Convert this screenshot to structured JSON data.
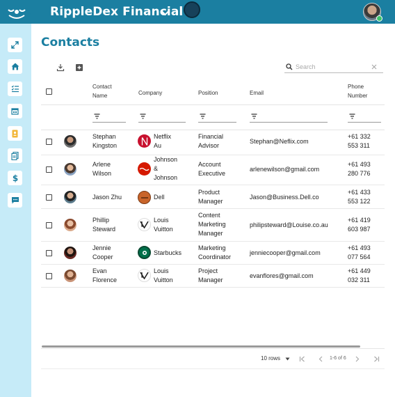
{
  "app": {
    "brand": "RippleDex Financial",
    "accent_color": "#1b7fa1",
    "sidebar_color": "#c6ebf8"
  },
  "sidebar": {
    "items": [
      {
        "icon": "expand-icon"
      },
      {
        "icon": "home-icon"
      },
      {
        "icon": "checklist-icon"
      },
      {
        "icon": "calendar-icon"
      },
      {
        "icon": "contacts-book-icon"
      },
      {
        "icon": "documents-icon"
      },
      {
        "icon": "dollar-icon"
      },
      {
        "icon": "chat-icon"
      }
    ]
  },
  "page": {
    "title": "Contacts",
    "search_placeholder": "Search"
  },
  "table": {
    "columns": {
      "contact_name": "Contact\nName",
      "company": "Company",
      "position": "Position",
      "email": "Email",
      "phone": "Phone\nNumber"
    },
    "rows": [
      {
        "name": "Stephan\nKingston",
        "company": "Netflix\nAu",
        "company_logo": "netflix-logo",
        "position": "Financial\nAdvisor",
        "email": "Stephan@Neflix.com",
        "phone": "+61 332\n553 311"
      },
      {
        "name": "Arlene\nWilson",
        "company": "Johnson\n&\nJohnson",
        "company_logo": "johnson-and-johnson-logo",
        "position": "Account\nExecutive",
        "email": "arlenewilson@gmail.com",
        "phone": "+61 493\n280 776"
      },
      {
        "name": "Jason Zhu",
        "company": "Dell",
        "company_logo": "dell-logo",
        "position": "Product\nManager",
        "email": "Jason@Business.Dell.co",
        "phone": "+61 433\n553 122"
      },
      {
        "name": "Phillip\nSteward",
        "company": "Louis\nVuitton",
        "company_logo": "louis-vuitton-logo",
        "position": "Content\nMarketing\nManager",
        "email": "philipsteward@Louise.co.au",
        "phone": "+61 419\n603 987"
      },
      {
        "name": "Jennie\nCooper",
        "company": "Starbucks",
        "company_logo": "starbucks-logo",
        "position": "Marketing\nCoordinator",
        "email": "jenniecooper@gmail.com",
        "phone": "+61 493\n077 564"
      },
      {
        "name": "Evan\nFlorence",
        "company": "Louis\nVuitton",
        "company_logo": "louis-vuitton-logo",
        "position": "Project\nManager",
        "email": "evanflores@gmail.com",
        "phone": "+61 449\n032 311"
      }
    ]
  },
  "pagination": {
    "rows_per_page": "10 rows",
    "range": "1-6 of 6"
  }
}
